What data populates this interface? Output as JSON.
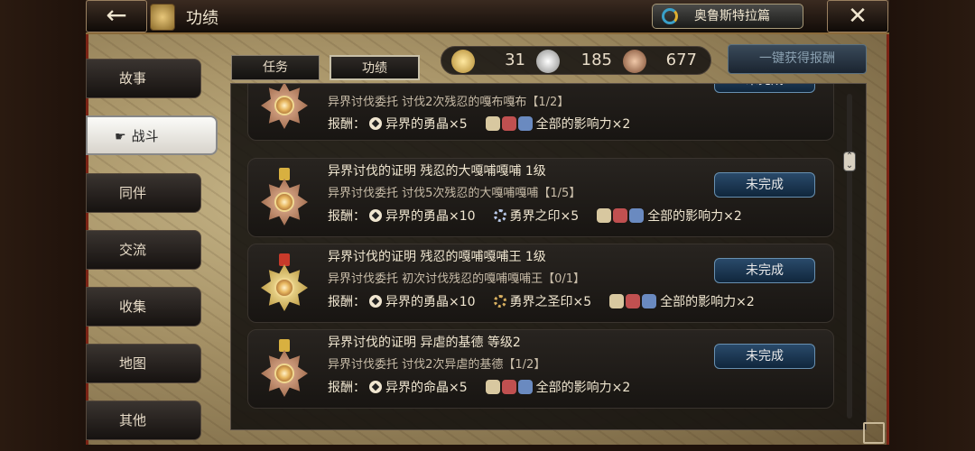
{
  "header": {
    "back_icon": "←",
    "title": "功绩",
    "arc_button": "奥鲁斯特拉篇",
    "close_icon": "✕"
  },
  "sidebar": {
    "items": [
      {
        "label": "故事",
        "active": false
      },
      {
        "label": "战斗",
        "active": true
      },
      {
        "label": "同伴",
        "active": false
      },
      {
        "label": "交流",
        "active": false
      },
      {
        "label": "收集",
        "active": false
      },
      {
        "label": "地图",
        "active": false
      },
      {
        "label": "其他",
        "active": false
      }
    ],
    "pointer_icon": "☛"
  },
  "tabs": [
    {
      "label": "任务",
      "active": false
    },
    {
      "label": "功绩",
      "active": true
    }
  ],
  "resources": {
    "gold_count": "31",
    "silver_count": "185",
    "bronze_count": "677"
  },
  "claim_all_button": "一键获得报酬",
  "rows": [
    {
      "title": "",
      "subtitle": "异界讨伐委托  讨伐2次残忍的嘎布嘎布【1/2】",
      "reward_label": "报酬：",
      "reward_item": "异界的勇晶×5",
      "secondary_reward": "",
      "influence": "全部的影响力×2",
      "status": "未完成",
      "medal": "bronze"
    },
    {
      "title": "异界讨伐的证明   残忍的大嘎哺嘎哺   1级",
      "subtitle": "异界讨伐委托  讨伐5次残忍的大嘎哺嘎哺【1/5】",
      "reward_label": "报酬：",
      "reward_item": "异界的勇晶×10",
      "secondary_reward": "勇界之印×5",
      "influence": "全部的影响力×2",
      "status": "未完成",
      "medal": "bronze"
    },
    {
      "title": "异界讨伐的证明   残忍的嘎哺嘎哺王   1级",
      "subtitle": "异界讨伐委托  初次讨伐残忍的嘎哺嘎哺王【0/1】",
      "reward_label": "报酬：",
      "reward_item": "异界的勇晶×10",
      "secondary_reward": "勇界之圣印×5",
      "influence": "全部的影响力×2",
      "status": "未完成",
      "medal": "gold"
    },
    {
      "title": "异界讨伐的证明  异虐的基德  等级2",
      "subtitle": "异界讨伐委托  讨伐2次异虐的基德【1/2】",
      "reward_label": "报酬：",
      "reward_item": "异界的命晶×5",
      "secondary_reward": "",
      "influence": "全部的影响力×2",
      "status": "未完成",
      "medal": "bronze"
    }
  ],
  "colors": {
    "bronze": "#b07a58",
    "gold": "#d8b040",
    "ribbon_gold": "#d8b040",
    "ribbon_red": "#c83a2a",
    "accent_blue": "#3a6a96"
  }
}
